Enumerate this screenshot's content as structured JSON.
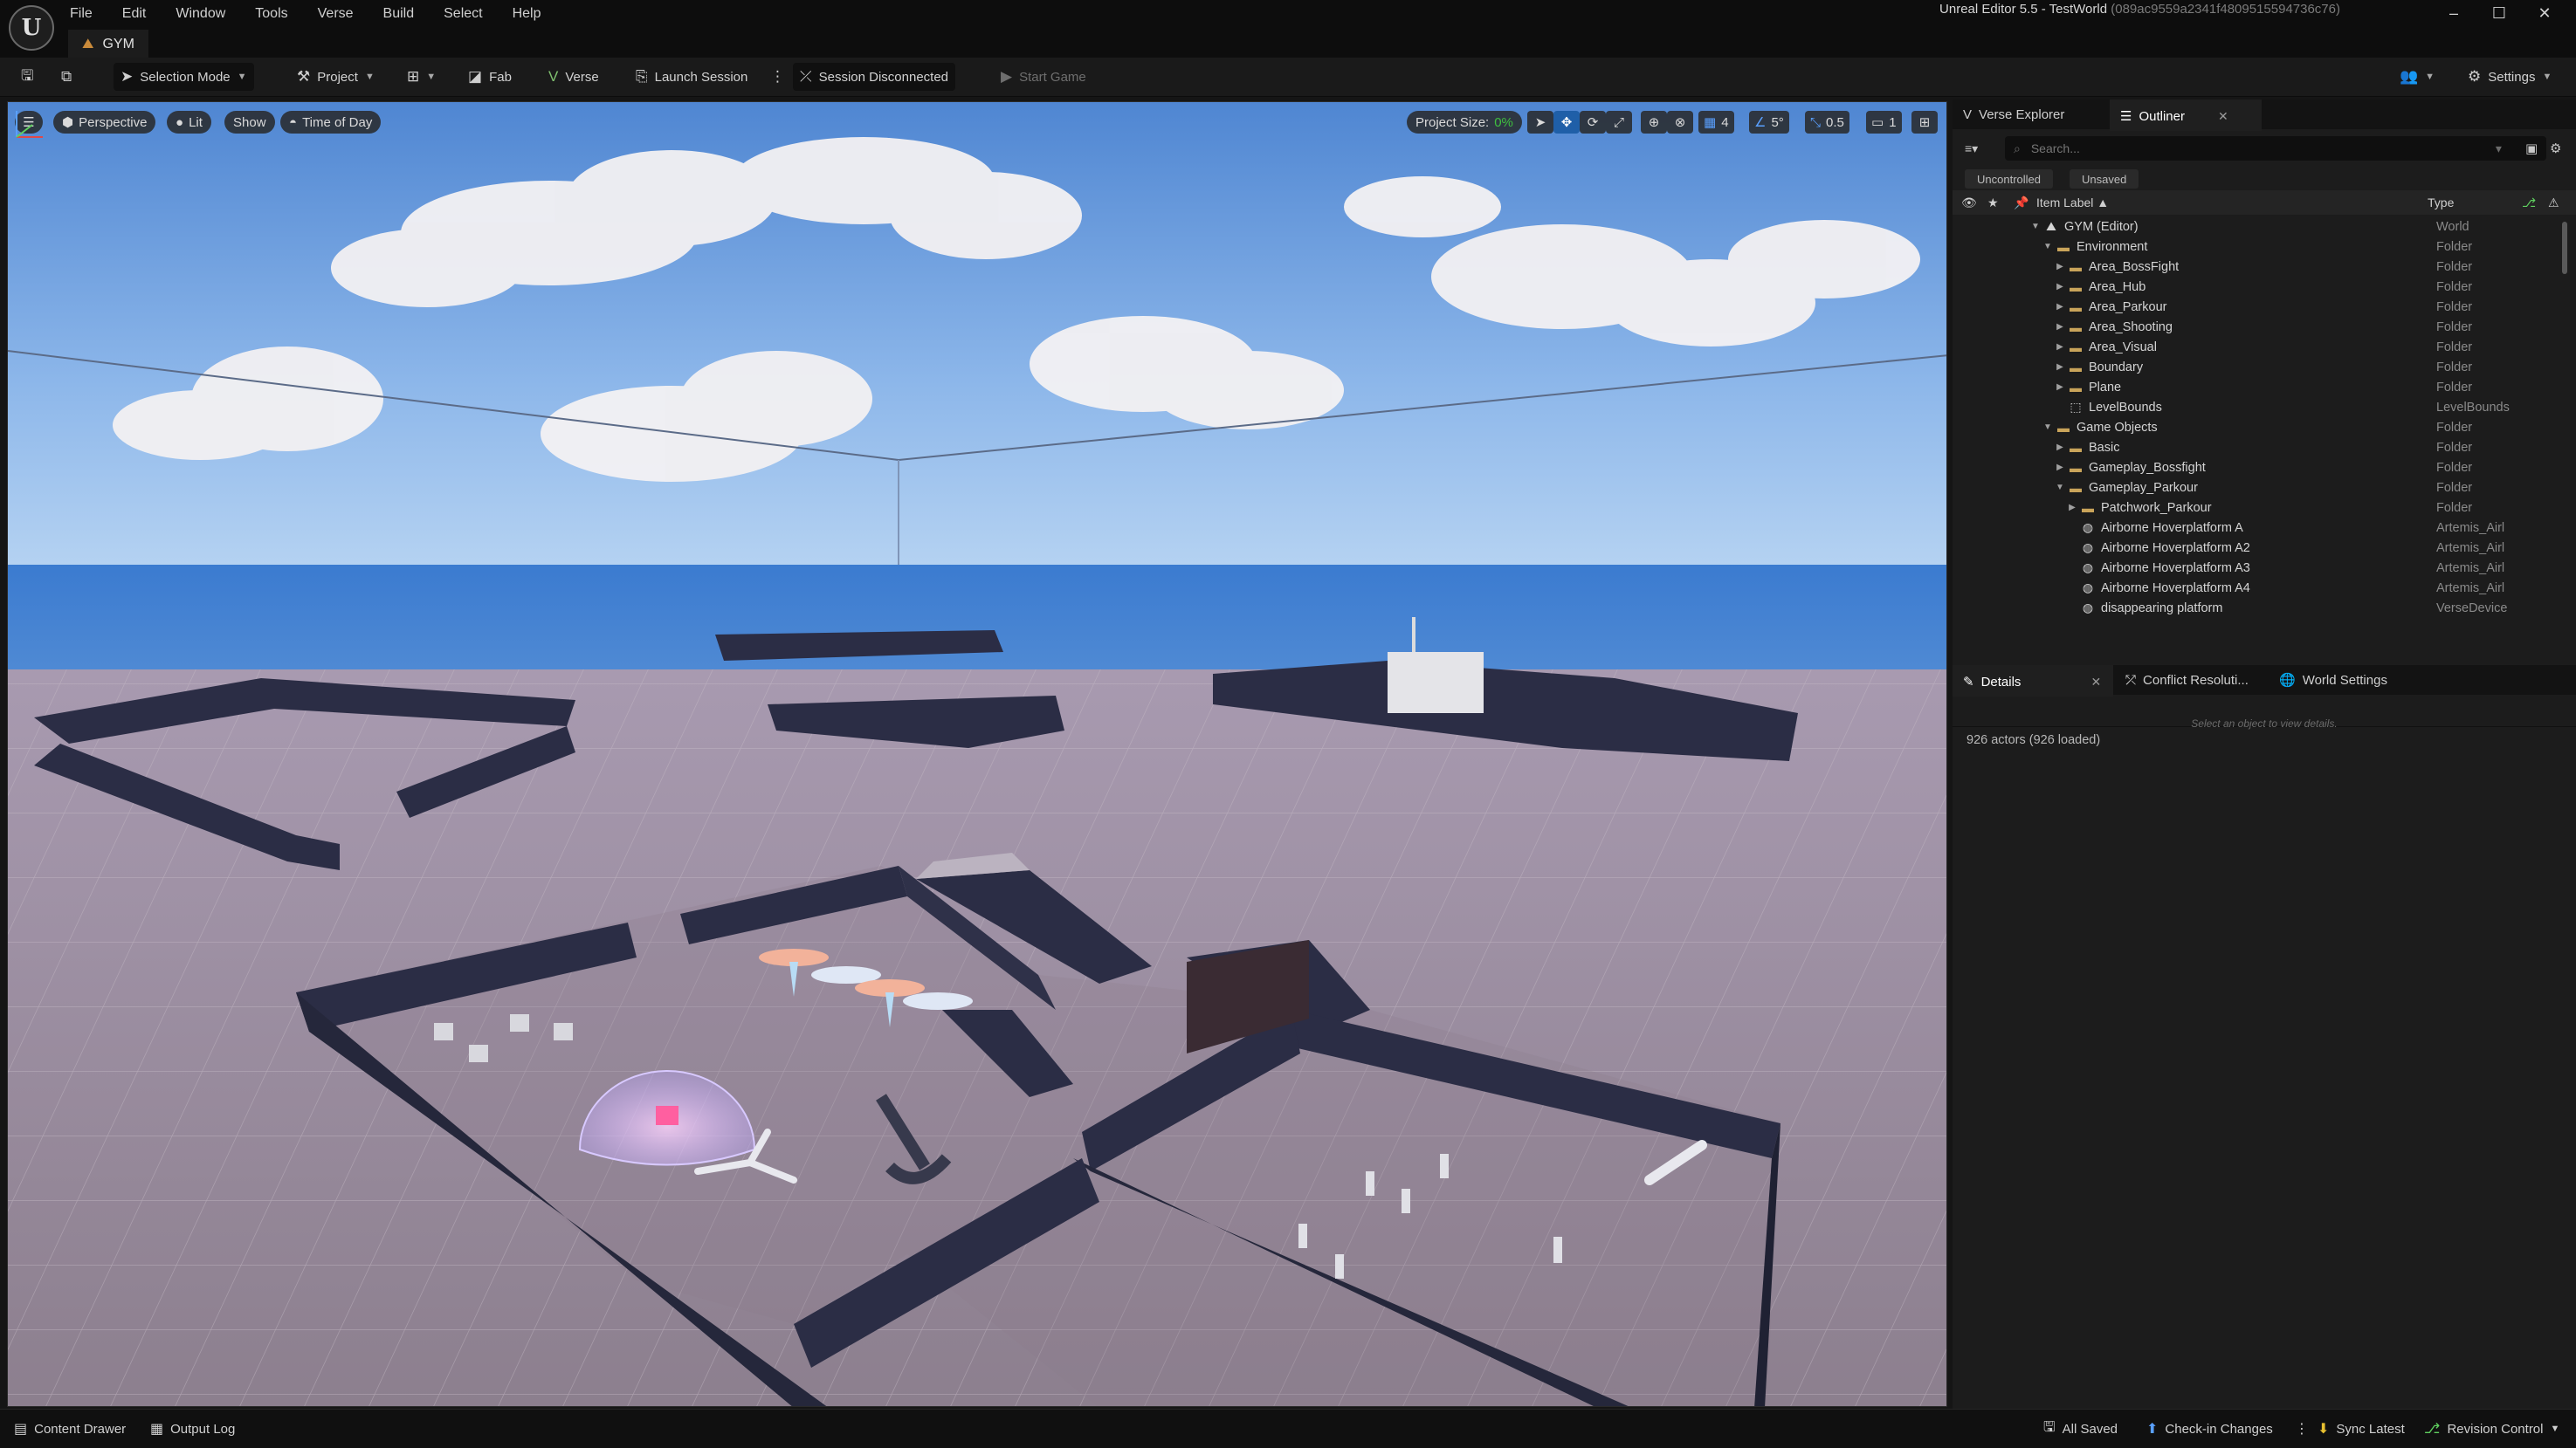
{
  "menu": [
    "File",
    "Edit",
    "Window",
    "Tools",
    "Verse",
    "Build",
    "Select",
    "Help"
  ],
  "map_tab": "GYM",
  "window_title": "Unreal Editor 5.5 - TestWorld",
  "window_hash": "(089ac9559a2341f4809515594736c76)",
  "toolbar": {
    "selection_mode": "Selection Mode",
    "project": "Project",
    "fab": "Fab",
    "verse": "Verse",
    "launch_session": "Launch Session",
    "session_status": "Session Disconnected",
    "start_game": "Start Game",
    "settings": "Settings"
  },
  "viewport": {
    "perspective": "Perspective",
    "lit": "Lit",
    "show": "Show",
    "time_of_day": "Time of Day",
    "project_size_label": "Project Size:",
    "project_size_value": "0%",
    "grid_snap": "4",
    "rotation_snap": "5°",
    "scale_snap": "0.5",
    "camera_speed": "1"
  },
  "outliner": {
    "tabs": [
      "Verse Explorer",
      "Outliner"
    ],
    "search_placeholder": "Search...",
    "filter_chips": [
      "Uncontrolled",
      "Unsaved"
    ],
    "col_label": "Item Label ▲",
    "col_type": "Type",
    "rows": [
      {
        "label": "GYM (Editor)",
        "type": "World",
        "depth": 0,
        "expanded": true,
        "icon": "world"
      },
      {
        "label": "Environment",
        "type": "Folder",
        "depth": 1,
        "expanded": true,
        "icon": "folder"
      },
      {
        "label": "Area_BossFight",
        "type": "Folder",
        "depth": 2,
        "expanded": false,
        "icon": "folder"
      },
      {
        "label": "Area_Hub",
        "type": "Folder",
        "depth": 2,
        "expanded": false,
        "icon": "folder"
      },
      {
        "label": "Area_Parkour",
        "type": "Folder",
        "depth": 2,
        "expanded": false,
        "icon": "folder"
      },
      {
        "label": "Area_Shooting",
        "type": "Folder",
        "depth": 2,
        "expanded": false,
        "icon": "folder"
      },
      {
        "label": "Area_Visual",
        "type": "Folder",
        "depth": 2,
        "expanded": false,
        "icon": "folder"
      },
      {
        "label": "Boundary",
        "type": "Folder",
        "depth": 2,
        "expanded": false,
        "icon": "folder"
      },
      {
        "label": "Plane",
        "type": "Folder",
        "depth": 2,
        "expanded": false,
        "icon": "folder"
      },
      {
        "label": "LevelBounds",
        "type": "LevelBounds",
        "depth": 2,
        "expanded": null,
        "icon": "bounds"
      },
      {
        "label": "Game Objects",
        "type": "Folder",
        "depth": 1,
        "expanded": true,
        "icon": "folder"
      },
      {
        "label": "Basic",
        "type": "Folder",
        "depth": 2,
        "expanded": false,
        "icon": "folder"
      },
      {
        "label": "Gameplay_Bossfight",
        "type": "Folder",
        "depth": 2,
        "expanded": false,
        "icon": "folder"
      },
      {
        "label": "Gameplay_Parkour",
        "type": "Folder",
        "depth": 2,
        "expanded": true,
        "icon": "folder"
      },
      {
        "label": "Patchwork_Parkour",
        "type": "Folder",
        "depth": 3,
        "expanded": false,
        "icon": "folder"
      },
      {
        "label": "Airborne Hoverplatform A",
        "type": "Artemis_Airl",
        "depth": 3,
        "expanded": null,
        "icon": "actor"
      },
      {
        "label": "Airborne Hoverplatform A2",
        "type": "Artemis_Airl",
        "depth": 3,
        "expanded": null,
        "icon": "actor"
      },
      {
        "label": "Airborne Hoverplatform A3",
        "type": "Artemis_Airl",
        "depth": 3,
        "expanded": null,
        "icon": "actor"
      },
      {
        "label": "Airborne Hoverplatform A4",
        "type": "Artemis_Airl",
        "depth": 3,
        "expanded": null,
        "icon": "actor"
      },
      {
        "label": "disappearing platform",
        "type": "VerseDevice",
        "depth": 3,
        "expanded": null,
        "icon": "actor"
      }
    ],
    "actor_count": "926 actors (926 loaded)"
  },
  "details": {
    "tabs": [
      "Details",
      "Conflict Resoluti...",
      "World Settings"
    ],
    "empty_hint": "Select an object to view details."
  },
  "statusbar": {
    "content_drawer": "Content Drawer",
    "output_log": "Output Log",
    "all_saved": "All Saved",
    "check_in": "Check-in Changes",
    "sync_latest": "Sync Latest",
    "revision_control": "Revision Control"
  },
  "colors": {
    "accent": "#1f5fa8",
    "folder": "#c9a45a",
    "sky_top": "#5d8fd4",
    "sky_horizon": "#a9c9ee",
    "ocean": "#3d7fd0",
    "floor": "#9a8d99",
    "walls": "#2b2d45",
    "project_size_green": "#3fbf3f"
  }
}
